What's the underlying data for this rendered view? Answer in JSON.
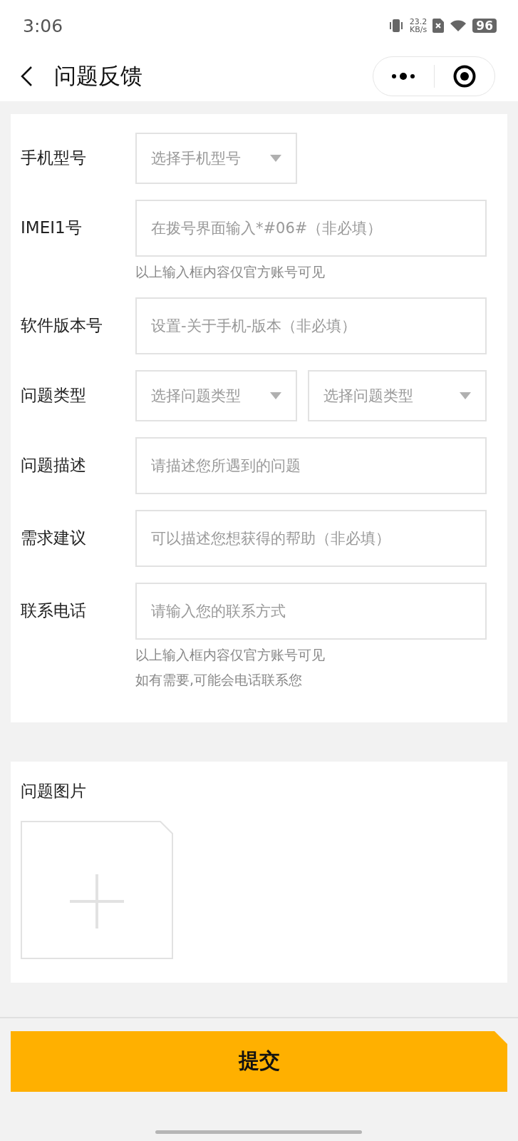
{
  "status_bar": {
    "time": "3:06",
    "speed": "23.2",
    "speed_unit": "KB/s",
    "battery": "96"
  },
  "header": {
    "title": "问题反馈"
  },
  "form": {
    "rows": [
      {
        "label": "手机型号",
        "fields": [
          {
            "kind": "select",
            "placeholder": "选择手机型号"
          }
        ]
      },
      {
        "label": "IMEI1号",
        "fields": [
          {
            "kind": "input",
            "placeholder": "在拨号界面输入*#06#（非必填）"
          }
        ],
        "notes": [
          "以上输入框内容仅官方账号可见"
        ]
      },
      {
        "label": "软件版本号",
        "fields": [
          {
            "kind": "input",
            "placeholder": "设置-关于手机-版本（非必填）"
          }
        ]
      },
      {
        "label": "问题类型",
        "fields": [
          {
            "kind": "select",
            "placeholder": "选择问题类型"
          },
          {
            "kind": "select",
            "placeholder": "选择问题类型"
          }
        ]
      },
      {
        "label": "问题描述",
        "fields": [
          {
            "kind": "input",
            "placeholder": "请描述您所遇到的问题"
          }
        ]
      },
      {
        "label": "需求建议",
        "fields": [
          {
            "kind": "input",
            "placeholder": "可以描述您想获得的帮助（非必填）"
          }
        ]
      },
      {
        "label": "联系电话",
        "fields": [
          {
            "kind": "input",
            "placeholder": "请输入您的联系方式"
          }
        ],
        "notes": [
          "以上输入框内容仅官方账号可见",
          "如有需要,可能会电话联系您"
        ]
      }
    ]
  },
  "photos": {
    "label": "问题图片"
  },
  "submit": "提交"
}
